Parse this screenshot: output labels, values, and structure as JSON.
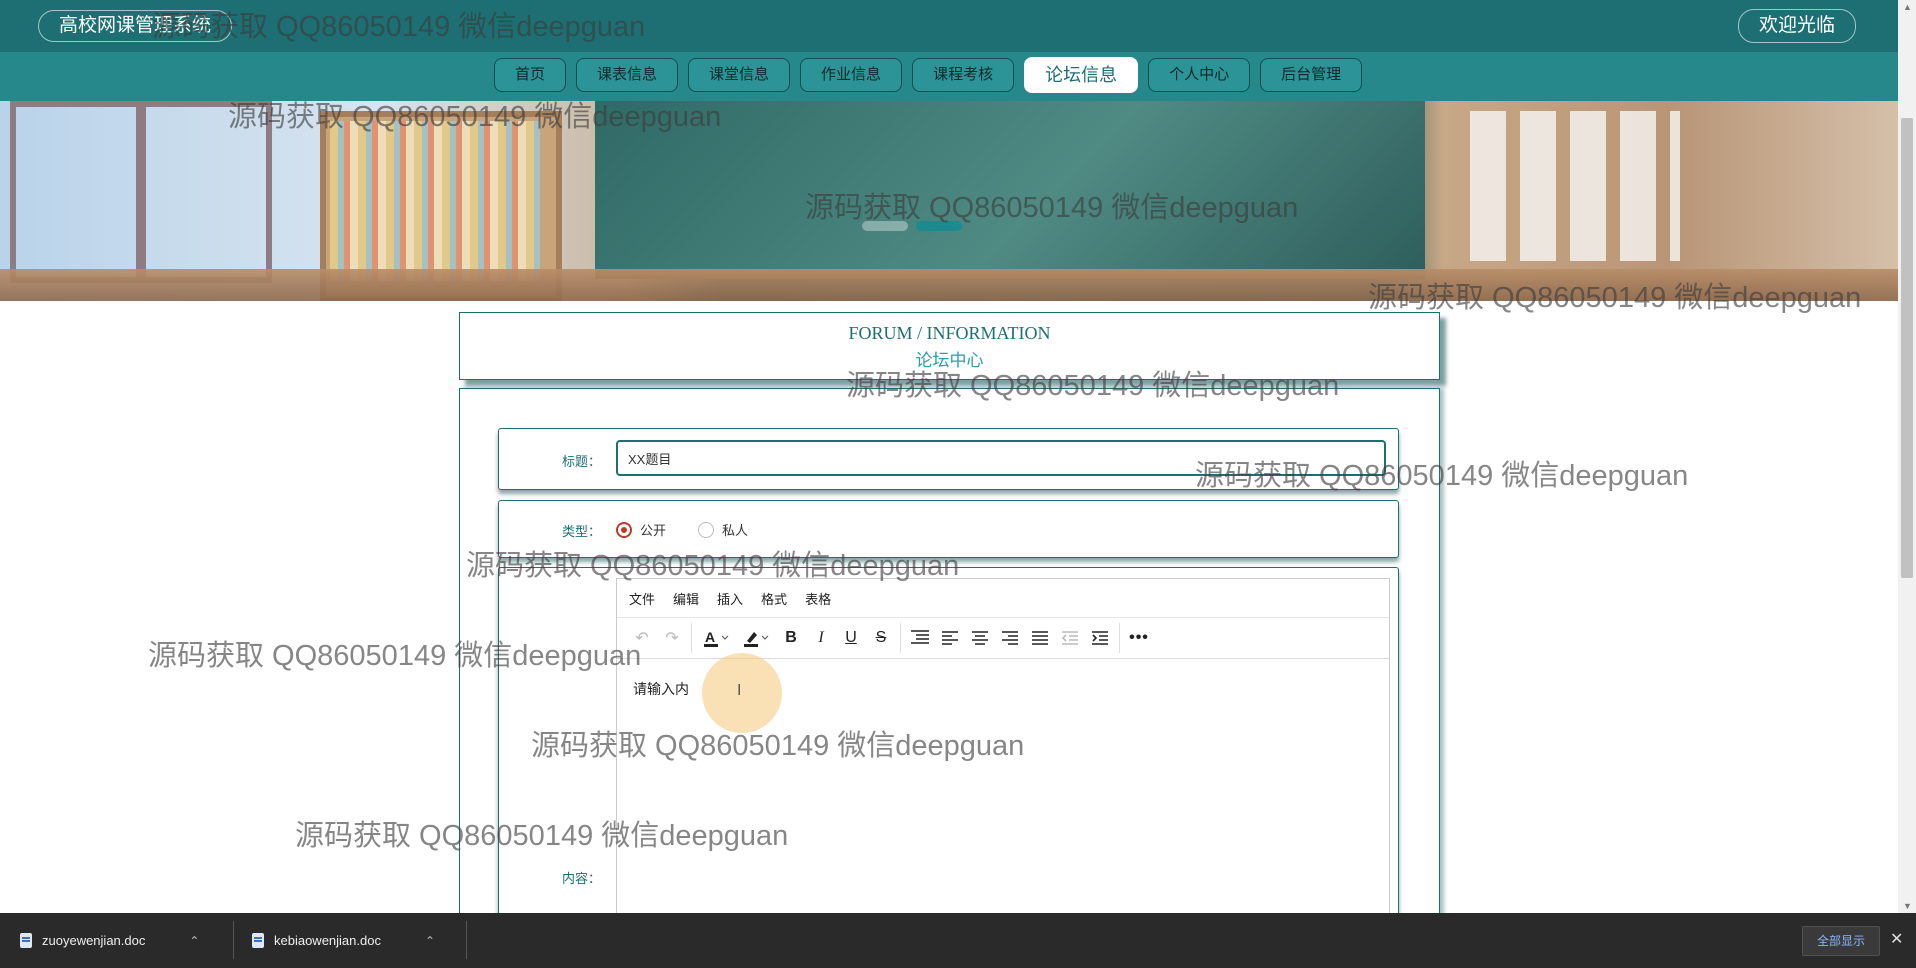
{
  "header": {
    "brand": "高校网课管理系统",
    "welcome": "欢迎光临"
  },
  "nav": {
    "items": [
      {
        "label": "首页"
      },
      {
        "label": "课表信息"
      },
      {
        "label": "课堂信息"
      },
      {
        "label": "作业信息"
      },
      {
        "label": "课程考核"
      },
      {
        "label": "论坛信息",
        "active": true
      },
      {
        "label": "个人中心"
      },
      {
        "label": "后台管理"
      }
    ]
  },
  "banner": {
    "slides": 2,
    "active_slide": 2
  },
  "section": {
    "title_en": "FORUM / INFORMATION",
    "title_cn": "论坛中心"
  },
  "form": {
    "title_label": "标题：",
    "title_value": "XX题目",
    "type_label": "类型：",
    "type_options": [
      {
        "label": "公开",
        "checked": true
      },
      {
        "label": "私人",
        "checked": false
      }
    ],
    "content_label": "内容："
  },
  "editor": {
    "menu": [
      "文件",
      "编辑",
      "插入",
      "格式",
      "表格"
    ],
    "toolbar_icons": [
      "undo-icon",
      "redo-icon",
      "text-color-icon",
      "highlight-icon",
      "bold-icon",
      "italic-icon",
      "underline-icon",
      "strikethrough-icon",
      "line-height-icon",
      "align-left-icon",
      "align-center-icon",
      "align-right-icon",
      "align-justify-icon",
      "outdent-icon",
      "indent-icon",
      "more-icon"
    ],
    "content_text": "请输入内"
  },
  "downloads": {
    "files": [
      {
        "name": "zuoyewenjian.doc"
      },
      {
        "name": "kebiaowenjian.doc"
      }
    ],
    "show_all": "全部显示"
  },
  "watermark": "源码获取 QQ86050149 微信deepguan",
  "colors": {
    "primary": "#1d6f73",
    "nav_bg": "#27888c",
    "accent": "#2aa0a6",
    "radio_checked": "#c0392b"
  }
}
